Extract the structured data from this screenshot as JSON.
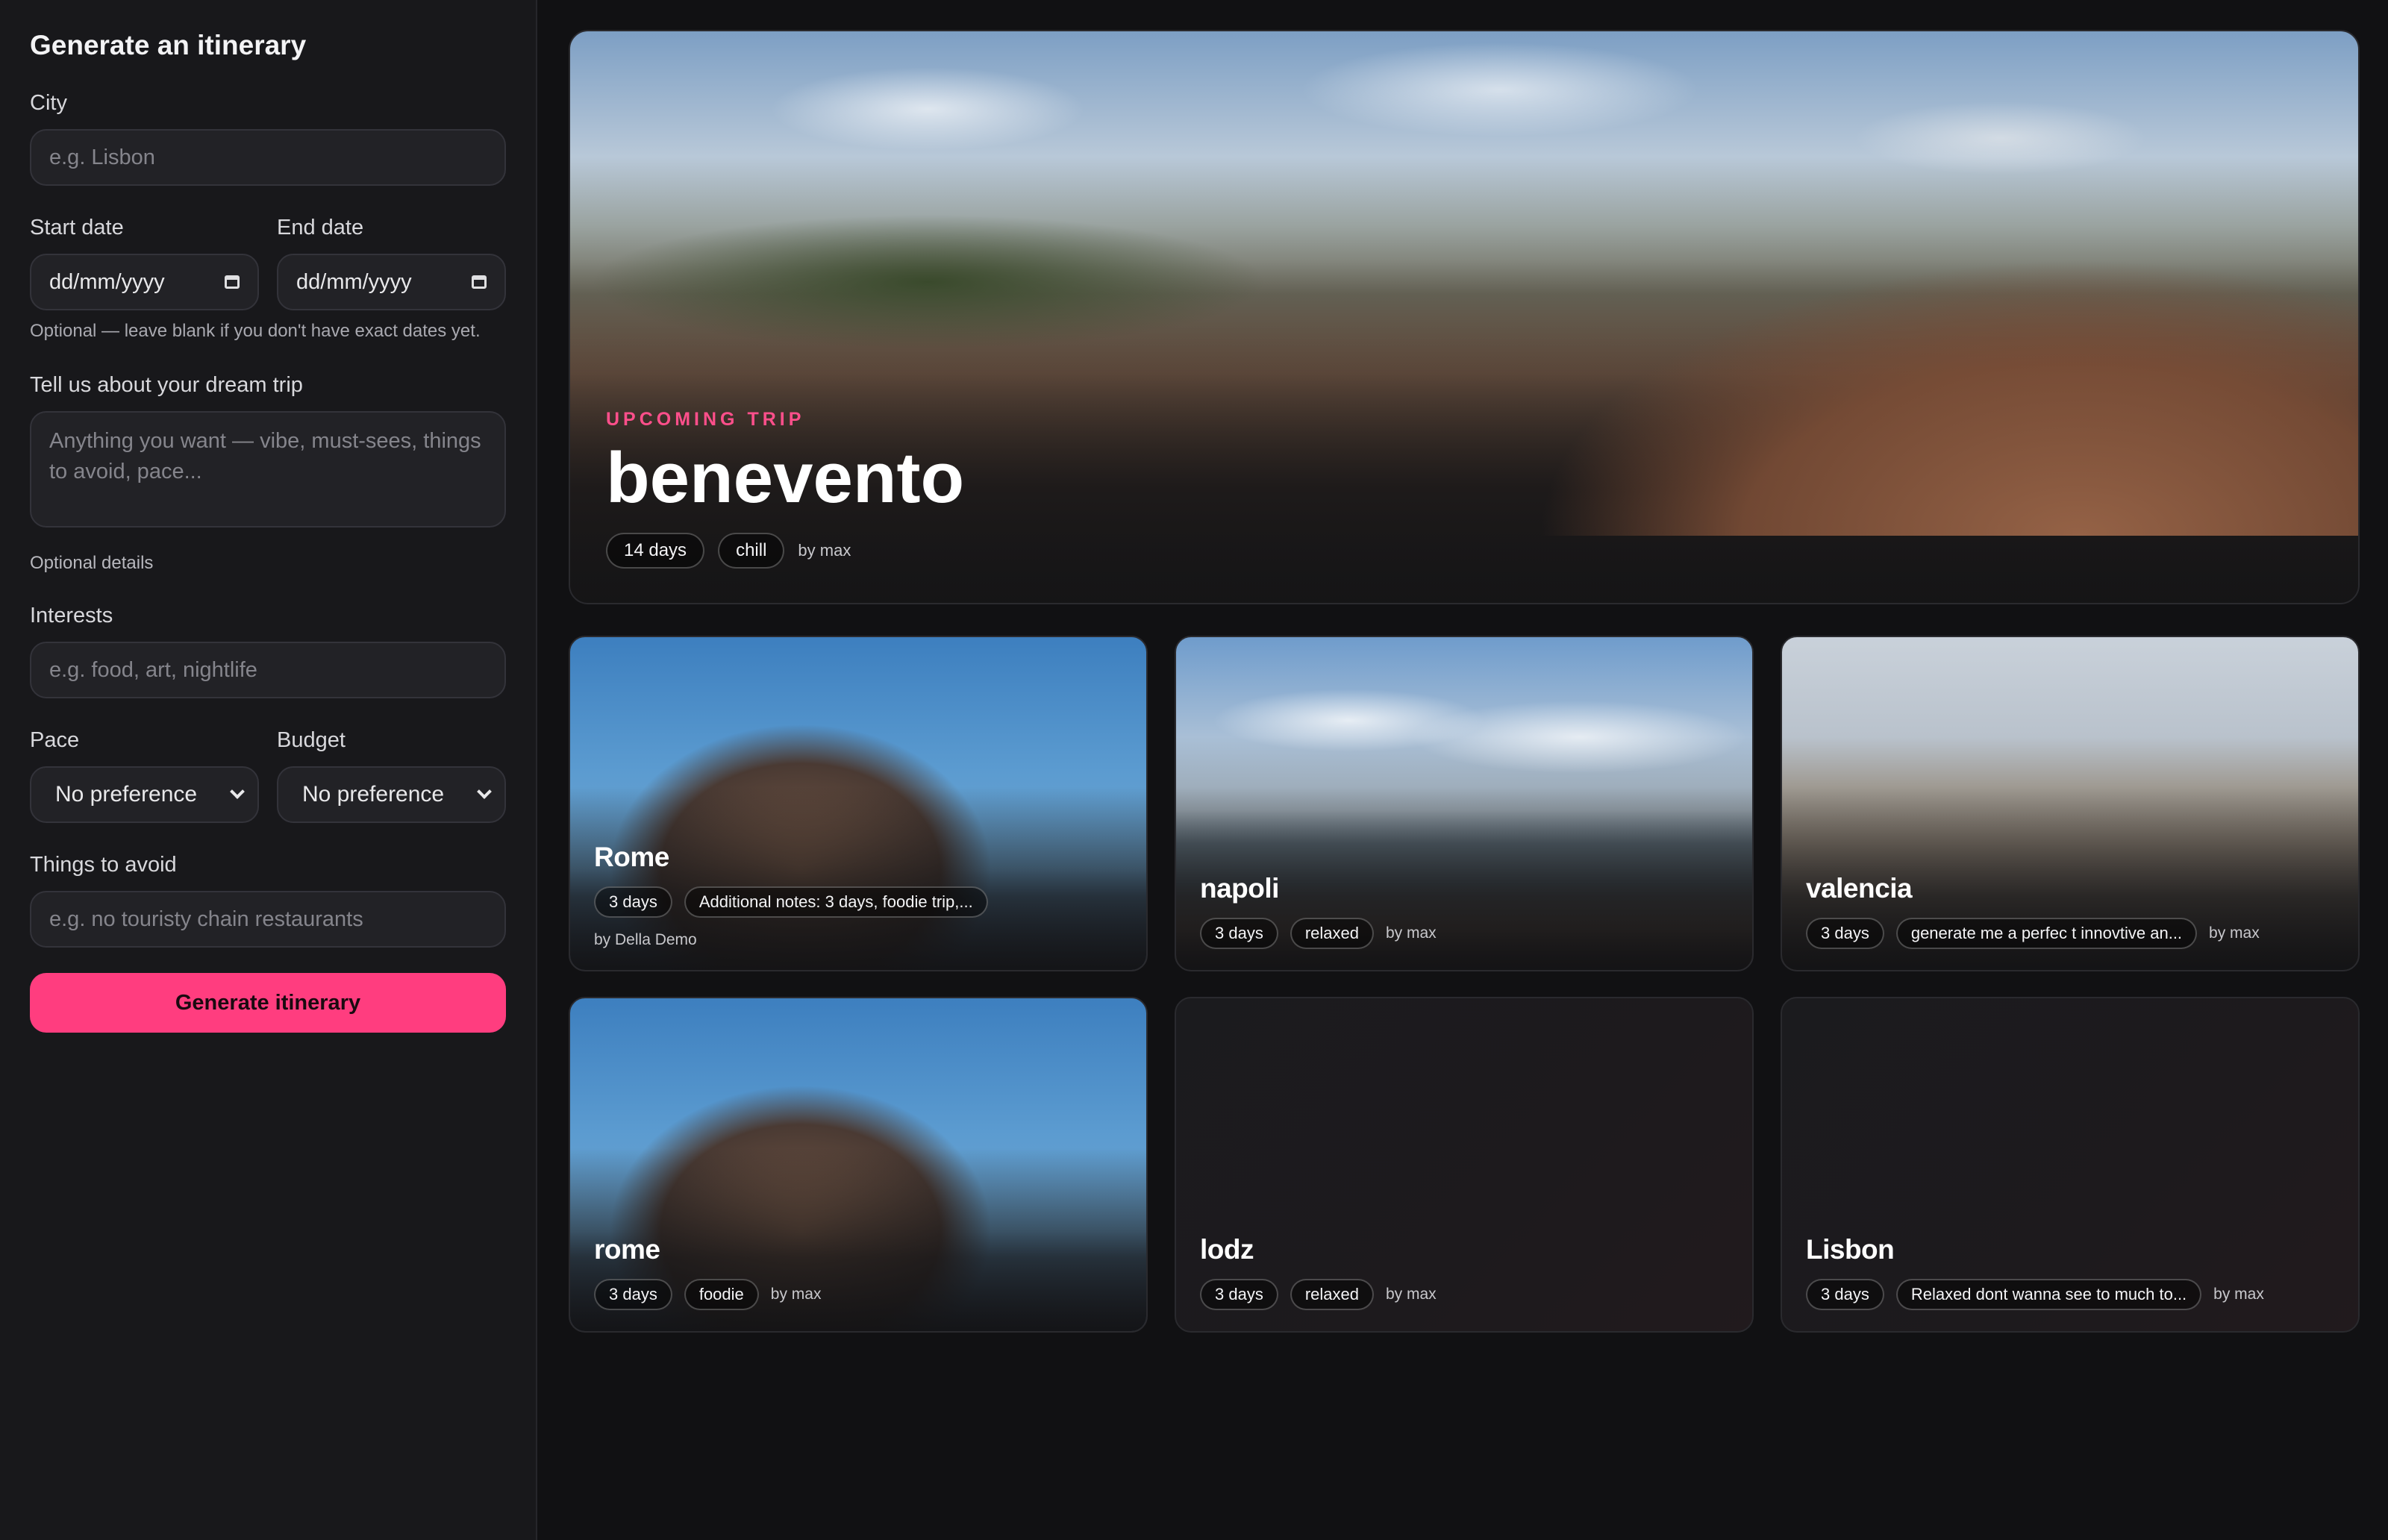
{
  "sidebar": {
    "title": "Generate an itinerary",
    "city": {
      "label": "City",
      "placeholder": "e.g. Lisbon"
    },
    "start_date": {
      "label": "Start date",
      "value": "dd/mm/yyyy"
    },
    "end_date": {
      "label": "End date",
      "value": "dd/mm/yyyy"
    },
    "dates_hint": "Optional — leave blank if you don't have exact dates yet.",
    "dream": {
      "label": "Tell us about your dream trip",
      "placeholder": "Anything you want — vibe, must-sees, things to avoid, pace..."
    },
    "optional_details": "Optional details",
    "interests": {
      "label": "Interests",
      "placeholder": "e.g. food, art, nightlife"
    },
    "pace": {
      "label": "Pace",
      "value": "No preference"
    },
    "budget": {
      "label": "Budget",
      "value": "No preference"
    },
    "avoid": {
      "label": "Things to avoid",
      "placeholder": "e.g. no touristy chain restaurants"
    },
    "button": "Generate itinerary"
  },
  "hero": {
    "eyebrow": "UPCOMING TRIP",
    "title": "benevento",
    "duration": "14 days",
    "style": "chill",
    "by": "by max"
  },
  "cards": [
    {
      "title": "Rome",
      "duration": "3 days",
      "tag": "Additional notes: 3 days, foodie trip,...",
      "by": "by Della Demo",
      "image": "colosseum"
    },
    {
      "title": "napoli",
      "duration": "3 days",
      "tag": "relaxed",
      "by": "by max",
      "image": "bay-of-naples"
    },
    {
      "title": "valencia",
      "duration": "3 days",
      "tag": "generate me a perfec t innovtive an...",
      "by": "by max",
      "image": "valencia-rooftops"
    },
    {
      "title": "rome",
      "duration": "3 days",
      "tag": "foodie",
      "by": "by max",
      "image": "colosseum"
    },
    {
      "title": "lodz",
      "duration": "3 days",
      "tag": "relaxed",
      "by": "by max",
      "image": "none"
    },
    {
      "title": "Lisbon",
      "duration": "3 days",
      "tag": "Relaxed dont wanna see to much to...",
      "by": "by max",
      "image": "none"
    }
  ],
  "colors": {
    "accent": "#ff3d7f",
    "eyebrow": "#ff4f8b",
    "bg": "#111113",
    "panel": "#18181b"
  }
}
